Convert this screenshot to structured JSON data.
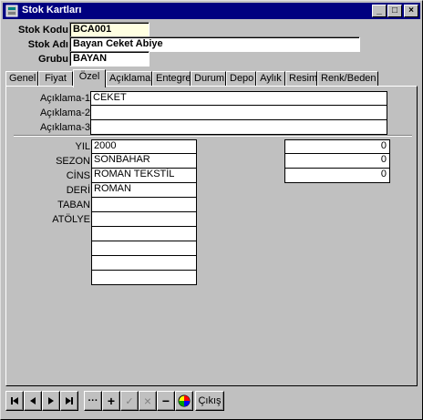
{
  "window": {
    "title": "Stok Kartları",
    "controls": {
      "minimize": "_",
      "maximize": "□",
      "close": "×"
    }
  },
  "header": {
    "code_label": "Stok Kodu",
    "code_value": "BCA001",
    "name_label": "Stok Adı",
    "name_value": "Bayan Ceket Abiye",
    "group_label": "Grubu",
    "group_value": "BAYAN"
  },
  "tabs": [
    {
      "label": "Genel"
    },
    {
      "label": "Fiyat"
    },
    {
      "label": "Özel"
    },
    {
      "label": "Açıklama"
    },
    {
      "label": "Entegre"
    },
    {
      "label": "Durum"
    },
    {
      "label": "Depo"
    },
    {
      "label": "Aylık"
    },
    {
      "label": "Resim"
    },
    {
      "label": "Renk/Beden"
    }
  ],
  "active_tab": "Özel",
  "descriptions": [
    {
      "label": "Açıklama-1",
      "value": "CEKET"
    },
    {
      "label": "Açıklama-2",
      "value": ""
    },
    {
      "label": "Açıklama-3",
      "value": ""
    }
  ],
  "attributes": [
    {
      "label": "YIL",
      "value": "2000"
    },
    {
      "label": "SEZON",
      "value": "SONBAHAR"
    },
    {
      "label": "CİNS",
      "value": "ROMAN TEKSTİL"
    },
    {
      "label": "DERİ",
      "value": "ROMAN"
    },
    {
      "label": "TABAN",
      "value": ""
    },
    {
      "label": "ATÖLYE",
      "value": ""
    },
    {
      "label": "",
      "value": ""
    },
    {
      "label": "",
      "value": ""
    },
    {
      "label": "",
      "value": ""
    },
    {
      "label": "",
      "value": ""
    }
  ],
  "numeric_fields": [
    "0",
    "0",
    "0"
  ],
  "navigator": {
    "first": "⏮",
    "prior": "◀",
    "next": "▶",
    "last": "⏭",
    "more": "···",
    "insert": "+",
    "post": "✓",
    "cancel": "×",
    "delete": "−",
    "exit_label": "Çıkış"
  },
  "colors": {
    "titlebar": "#000080",
    "face": "#c0c0c0",
    "code_field": "#ffffe1"
  }
}
